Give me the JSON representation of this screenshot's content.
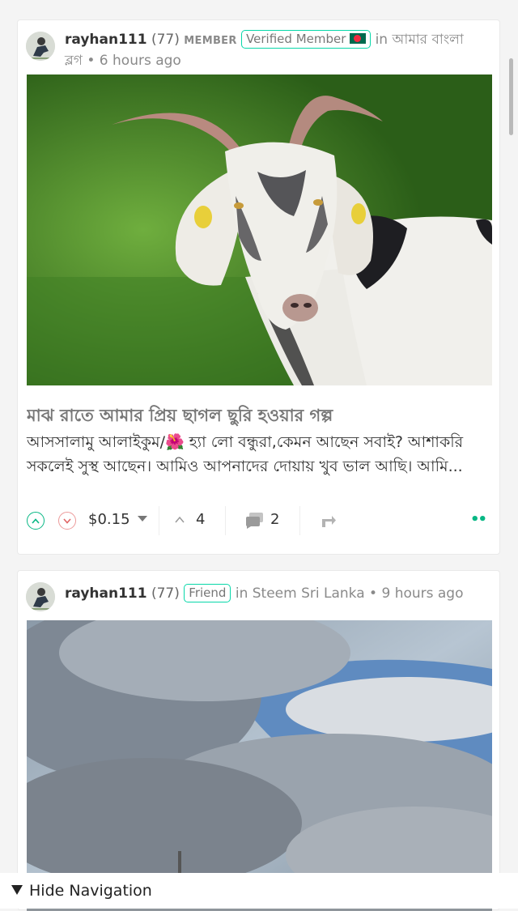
{
  "posts": [
    {
      "author": "rayhan111",
      "reputation": "(77)",
      "role": "MEMBER",
      "badge": "Verified Member",
      "community_prefix": "in",
      "community": "আমার বাংলা ব্লগ",
      "time": "6 hours ago",
      "image_subject": "goat photo",
      "title": "মাঝ রাতে আমার প্রিয় ছাগল ছুরি হওয়ার গল্প",
      "body": "আসসালামু আলাইকুম/🌺 হ্যা লো বন্ধুরা,কেমন আছেন সবাই? আশাকরি সকলেই সুস্থ আছেন। আমিও আপনাদের দোয়ায় খুব ভাল আছি। আমি...",
      "payout": "$0.15",
      "votes": "4",
      "comments": "2"
    },
    {
      "author": "rayhan111",
      "reputation": "(77)",
      "badge": "Friend",
      "community_prefix": "in",
      "community": "Steem Sri Lanka",
      "time": "9 hours ago",
      "image_subject": "cloudy sky photo"
    }
  ],
  "navigation": {
    "hide_label": "Hide Navigation"
  },
  "colors": {
    "accent": "#07d7a9",
    "upvote": "#07b784",
    "downvote": "#e06666"
  },
  "icons": {
    "upvote": "chevron-up-circle-icon",
    "downvote": "chevron-down-circle-icon",
    "votes": "chevron-up-icon",
    "comments": "comment-bubble-icon",
    "reblog": "reblog-icon",
    "more": "more-dots-icon",
    "hide_nav": "triangle-down-icon"
  }
}
